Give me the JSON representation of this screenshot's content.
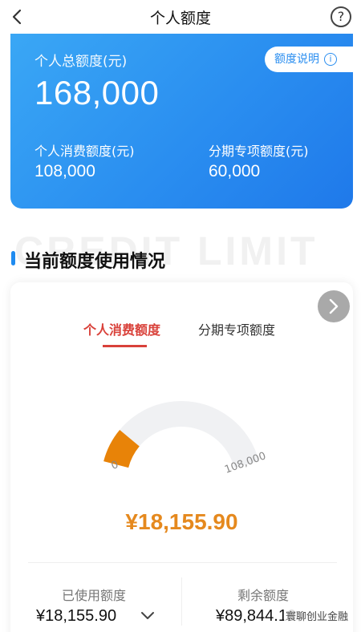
{
  "nav": {
    "title": "个人额度",
    "help_glyph": "?",
    "back_icon": "chevron-left-icon"
  },
  "hero": {
    "total_label": "个人总额度(元)",
    "total_value": "168,000",
    "explain_label": "额度说明",
    "explain_icon_glyph": "i",
    "consume_label": "个人消费额度(元)",
    "consume_value": "108,000",
    "installment_label": "分期专项额度(元)",
    "installment_value": "60,000",
    "gradient_start": "#3aa7f5",
    "gradient_end": "#1f79ea"
  },
  "section": {
    "background_text": "CREDIT LIMIT",
    "title": "当前额度使用情况",
    "accent": "#1f8bf0"
  },
  "card": {
    "tabs": [
      {
        "label": "个人消费额度",
        "active": true
      },
      {
        "label": "分期专项额度",
        "active": false
      }
    ],
    "gauge": {
      "min_label": "0",
      "max_label": "108,000",
      "min": 0,
      "max": 108000,
      "used": 18155.9,
      "fill_color": "#e88308",
      "track_color": "#f0f1f3"
    },
    "used_amount_display": "¥18,155.90",
    "used_label": "已使用额度",
    "used_value": "¥18,155.90",
    "remaining_label": "剩余额度",
    "remaining_value": "¥89,844.10",
    "active_color": "#d9413a",
    "amount_color": "#e5891e"
  },
  "watermark": "寰聊创业金融"
}
